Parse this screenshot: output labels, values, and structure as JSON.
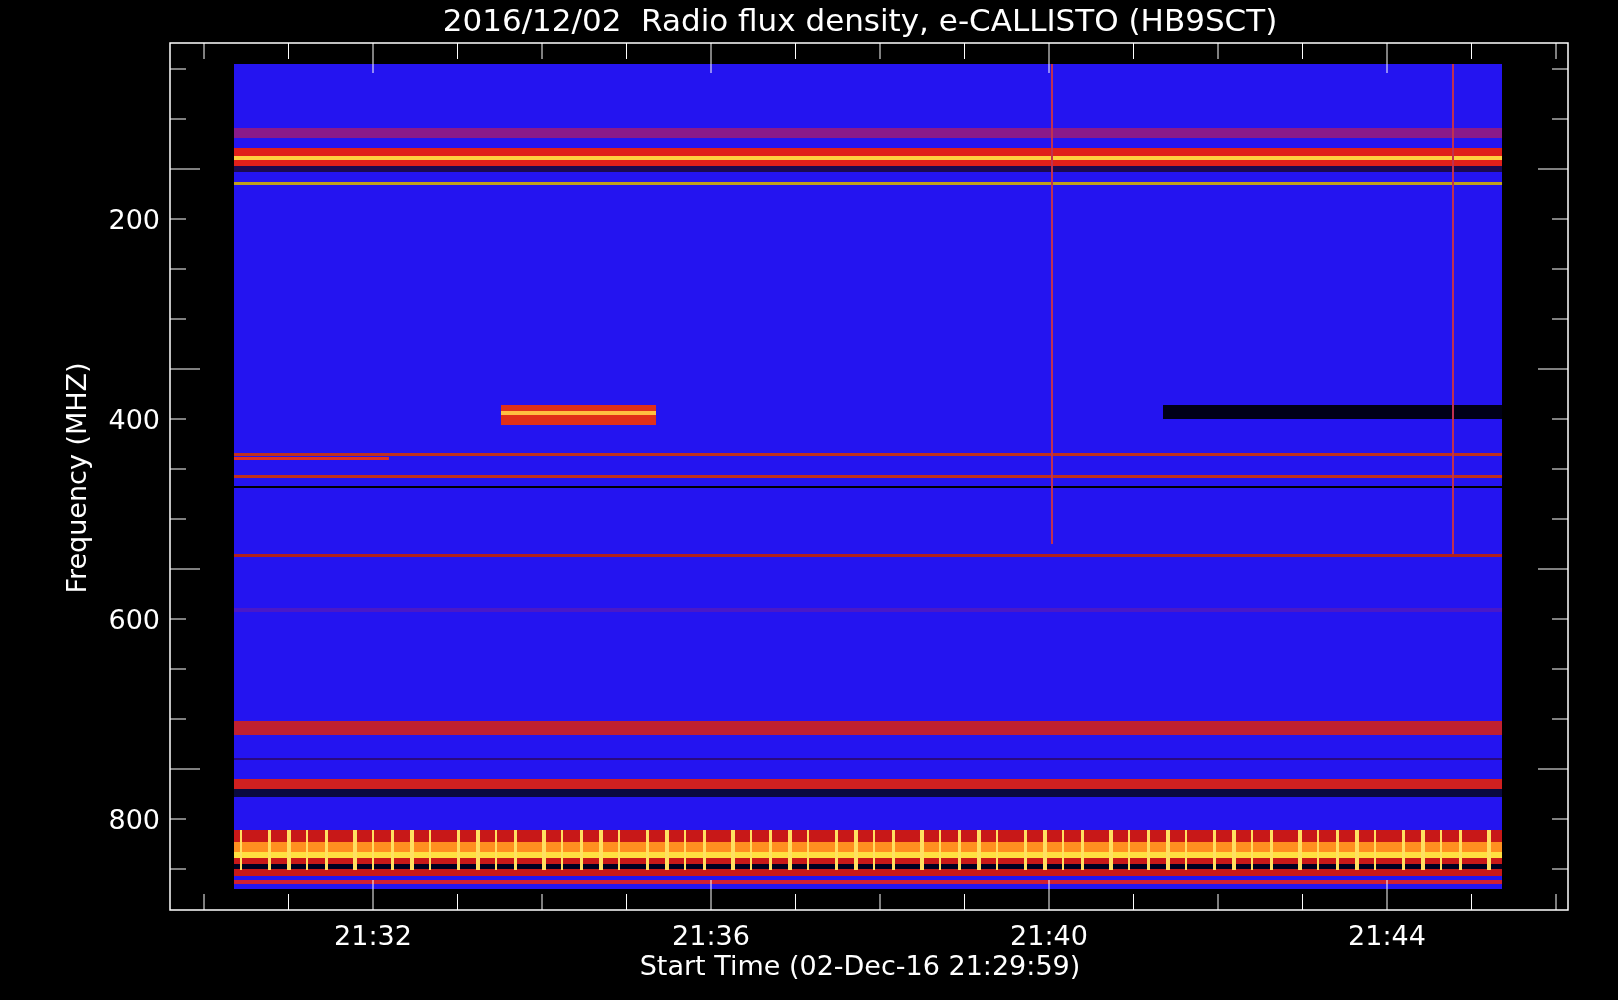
{
  "plot": {
    "title": "2016/12/02  Radio flux density, e-CALLISTO (HB9SCT)",
    "xlabel": "Start Time (02-Dec-16 21:29:59)",
    "ylabel": "Frequency (MHZ)",
    "y_tick_labels": [
      "200",
      "400",
      "600",
      "800"
    ],
    "x_tick_labels": [
      "21:32",
      "21:36",
      "21:40",
      "21:44"
    ]
  }
}
